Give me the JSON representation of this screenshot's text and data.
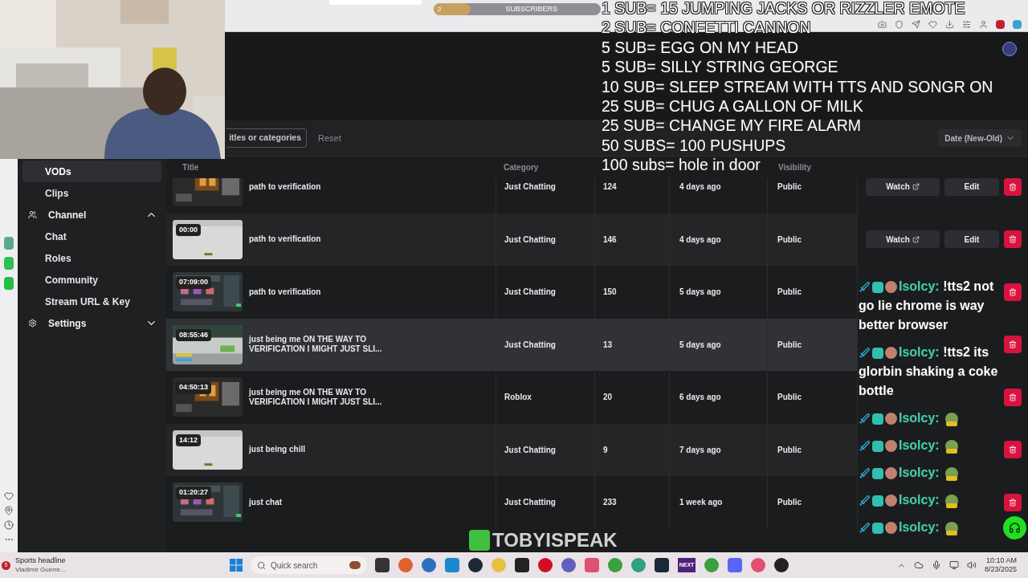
{
  "sub_goal_bar": {
    "count": "2",
    "label": "SUBSCRIBERS",
    "level": 0.22
  },
  "sub_goals": [
    "1 SUB= 15 JUMPING JACKS OR RIZZLER EMOTE",
    "2 SUB= CONFETTI CANNON",
    "5 SUB= EGG ON MY HEAD",
    "5 SUB= SILLY STRING GEORGE",
    "10 SUB= SLEEP STREAM WITH TTS AND SONGR ON",
    "25 SUB= CHUG A GALLON OF MILK",
    "25 SUB= CHANGE MY FIRE ALARM",
    "50 SUBS= 100 PUSHUPS",
    "100 subs= hole in door"
  ],
  "sidebar": {
    "items": [
      {
        "label": "VODs",
        "kind": "link",
        "selected": true
      },
      {
        "label": "Clips",
        "kind": "link",
        "selected": false
      },
      {
        "label": "Channel",
        "kind": "section",
        "expanded": true
      },
      {
        "label": "Chat",
        "kind": "link",
        "selected": false
      },
      {
        "label": "Roles",
        "kind": "link",
        "selected": false
      },
      {
        "label": "Community",
        "kind": "link",
        "selected": false
      },
      {
        "label": "Stream URL & Key",
        "kind": "link",
        "selected": false
      },
      {
        "label": "Settings",
        "kind": "section",
        "expanded": false
      }
    ]
  },
  "filter": {
    "search_placeholder": "itles or categories",
    "reset": "Reset",
    "sort": "Date (New-Old)"
  },
  "table": {
    "columns": {
      "title": "Title",
      "category": "Category",
      "visibility": "Visibility"
    },
    "rows": [
      {
        "title": "path to verification",
        "category": "Just Chatting",
        "views": "124",
        "date": "4 days ago",
        "visibility": "Public",
        "watch": "Watch",
        "edit": "Edit",
        "highlighted": false
      },
      {
        "duration": "00:00",
        "title": "path to verification",
        "category": "Just Chatting",
        "views": "146",
        "date": "4 days ago",
        "visibility": "Public",
        "watch": "Watch",
        "edit": "Edit",
        "highlighted": false
      },
      {
        "duration": "07:09:00",
        "title": "path to verification",
        "category": "Just Chatting",
        "views": "150",
        "date": "5 days ago",
        "visibility": "Public",
        "highlighted": false
      },
      {
        "duration": "08:55:46",
        "title": "just being me ON THE WAY TO VERIFICATION I MIGHT JUST SLI...",
        "category": "Just Chatting",
        "views": "13",
        "date": "5 days ago",
        "visibility": "Public",
        "highlighted": true
      },
      {
        "duration": "04:50:13",
        "title": "just being me ON THE WAY TO VERIFICATION I MIGHT JUST SLI...",
        "category": "Roblox",
        "views": "20",
        "date": "6 days ago",
        "visibility": "Public",
        "highlighted": false
      },
      {
        "duration": "14:12",
        "title": "just being chill",
        "category": "Just Chatting",
        "views": "9",
        "date": "7 days ago",
        "visibility": "Public",
        "highlighted": false
      },
      {
        "duration": "01:20:27",
        "title": "just chat",
        "category": "Just Chatting",
        "views": "233",
        "date": "1 week ago",
        "visibility": "Public",
        "highlighted": false
      }
    ]
  },
  "chat": [
    {
      "name": "Isolcy:",
      "kind": "text",
      "message": "!tts2 not go lie chrome is way better browser"
    },
    {
      "name": "Isolcy:",
      "kind": "text",
      "message": "!tts2 its glorbin shaking a coke bottle"
    },
    {
      "name": "Isolcy:",
      "kind": "emote"
    },
    {
      "name": "Isolcy:",
      "kind": "emote"
    },
    {
      "name": "Isolcy:",
      "kind": "emote"
    },
    {
      "name": "Isolcy:",
      "kind": "emote"
    },
    {
      "name": "Isolcy:",
      "kind": "emote"
    }
  ],
  "logo": "TOBYISPEAK",
  "taskbar": {
    "news_count": "5",
    "news_title": "Sports headline",
    "news_subtitle": "Vladimir Guerre...",
    "search_placeholder": "Quick search",
    "app_label": "NEXT",
    "time": "10:10 AM",
    "date": "8/23/2025"
  }
}
